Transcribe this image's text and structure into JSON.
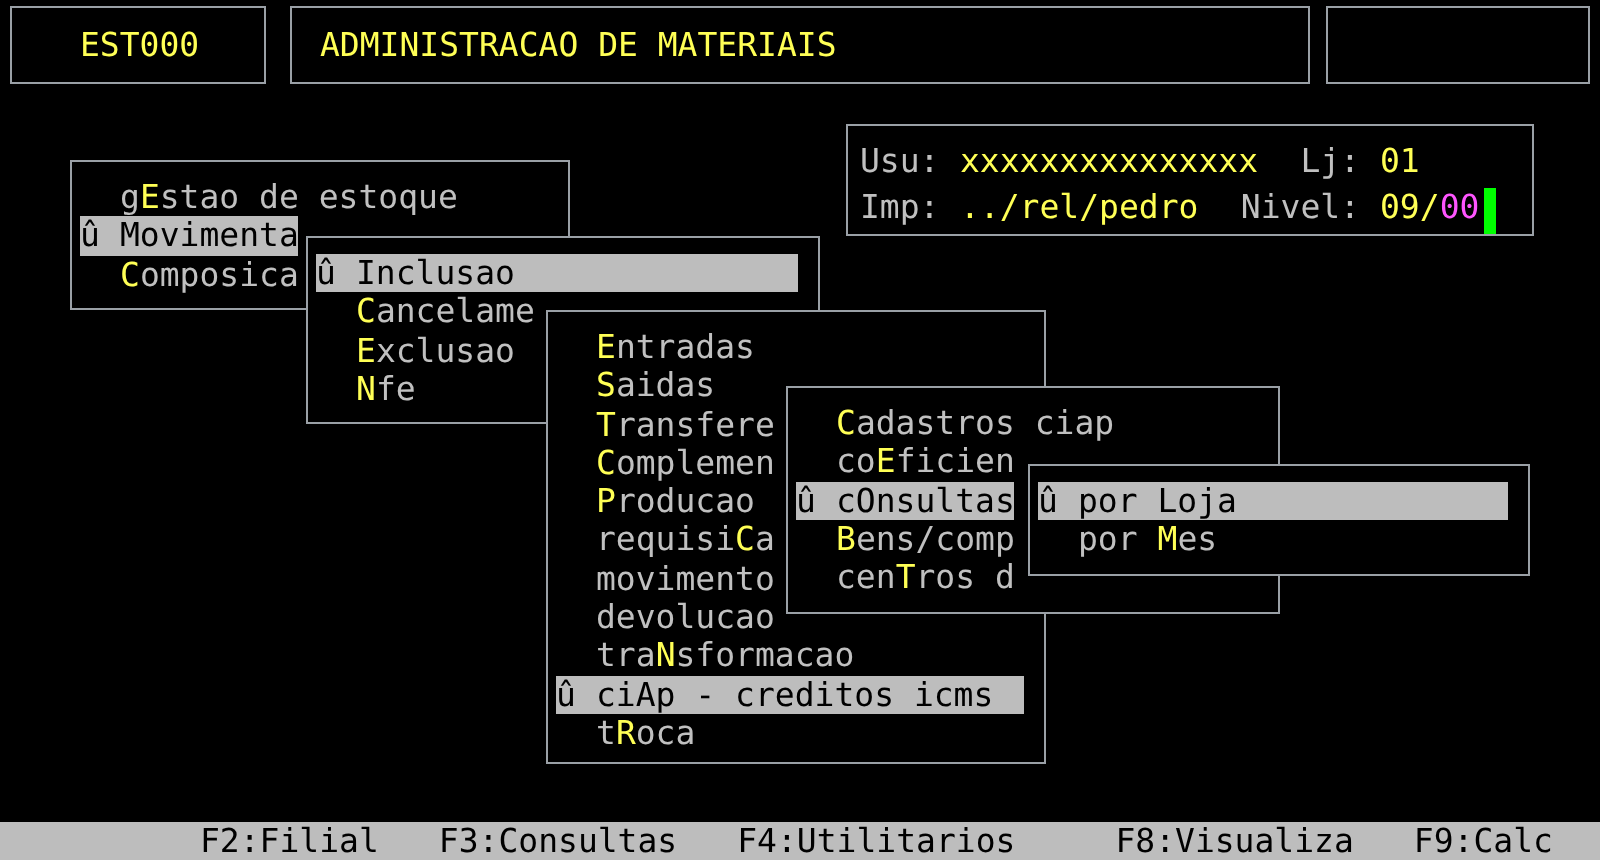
{
  "header": {
    "code": "EST000",
    "title": "ADMINISTRACAO DE MATERIAIS"
  },
  "session": {
    "user_label": "Usu:",
    "user": "xxxxxxxxxxxxxxx",
    "store_label": "Lj:",
    "store": "01",
    "printer_label": "Imp:",
    "printer": "../rel/pedro",
    "level_label": "Nivel:",
    "level_value": "09/",
    "level_sub": "00"
  },
  "menus": [
    {
      "items": [
        {
          "selected": false,
          "parts": [
            {
              "text": "g",
              "hotkey": false
            },
            {
              "text": "E",
              "hotkey": true
            },
            {
              "text": "stao de estoque",
              "hotkey": false
            }
          ]
        },
        {
          "selected": true,
          "prefix": "û",
          "parts": [
            {
              "text": "Movimenta",
              "hotkey": false
            }
          ]
        },
        {
          "selected": false,
          "parts": [
            {
              "text": "C",
              "hotkey": true
            },
            {
              "text": "omposica",
              "hotkey": false
            }
          ]
        }
      ]
    },
    {
      "items": [
        {
          "selected": true,
          "prefix": "û",
          "parts": [
            {
              "text": "Inclusao",
              "hotkey": false
            }
          ]
        },
        {
          "selected": false,
          "parts": [
            {
              "text": "C",
              "hotkey": true
            },
            {
              "text": "ancelame",
              "hotkey": false
            }
          ]
        },
        {
          "selected": false,
          "parts": [
            {
              "text": "E",
              "hotkey": true
            },
            {
              "text": "xclusao",
              "hotkey": false
            }
          ]
        },
        {
          "selected": false,
          "parts": [
            {
              "text": "N",
              "hotkey": true
            },
            {
              "text": "fe",
              "hotkey": false
            }
          ]
        }
      ]
    },
    {
      "items": [
        {
          "selected": false,
          "parts": [
            {
              "text": "E",
              "hotkey": true
            },
            {
              "text": "ntradas",
              "hotkey": false
            }
          ]
        },
        {
          "selected": false,
          "parts": [
            {
              "text": "S",
              "hotkey": true
            },
            {
              "text": "aidas",
              "hotkey": false
            }
          ]
        },
        {
          "selected": false,
          "parts": [
            {
              "text": "T",
              "hotkey": true
            },
            {
              "text": "ransfere",
              "hotkey": false
            }
          ]
        },
        {
          "selected": false,
          "parts": [
            {
              "text": "C",
              "hotkey": true
            },
            {
              "text": "omplemen",
              "hotkey": false
            }
          ]
        },
        {
          "selected": false,
          "parts": [
            {
              "text": "P",
              "hotkey": true
            },
            {
              "text": "roducao",
              "hotkey": false
            }
          ]
        },
        {
          "selected": false,
          "parts": [
            {
              "text": "requisi",
              "hotkey": false
            },
            {
              "text": "C",
              "hotkey": true
            },
            {
              "text": "a",
              "hotkey": false
            }
          ]
        },
        {
          "selected": false,
          "parts": [
            {
              "text": "movimento",
              "hotkey": false
            }
          ]
        },
        {
          "selected": false,
          "parts": [
            {
              "text": "devolucao",
              "hotkey": false
            }
          ]
        },
        {
          "selected": false,
          "parts": [
            {
              "text": "tra",
              "hotkey": false
            },
            {
              "text": "N",
              "hotkey": true
            },
            {
              "text": "sformacao",
              "hotkey": false
            }
          ]
        },
        {
          "selected": true,
          "prefix": "û",
          "parts": [
            {
              "text": "ciAp - creditos icms",
              "hotkey": false
            }
          ]
        },
        {
          "selected": false,
          "parts": [
            {
              "text": "t",
              "hotkey": false
            },
            {
              "text": "R",
              "hotkey": true
            },
            {
              "text": "oca",
              "hotkey": false
            }
          ]
        }
      ]
    },
    {
      "items": [
        {
          "selected": false,
          "parts": [
            {
              "text": "C",
              "hotkey": true
            },
            {
              "text": "adastros ciap",
              "hotkey": false
            }
          ]
        },
        {
          "selected": false,
          "parts": [
            {
              "text": "co",
              "hotkey": false
            },
            {
              "text": "E",
              "hotkey": true
            },
            {
              "text": "ficien",
              "hotkey": false
            }
          ]
        },
        {
          "selected": true,
          "prefix": "û",
          "parts": [
            {
              "text": "cOnsultas",
              "hotkey": false
            }
          ]
        },
        {
          "selected": false,
          "parts": [
            {
              "text": "B",
              "hotkey": true
            },
            {
              "text": "ens/comp",
              "hotkey": false
            }
          ]
        },
        {
          "selected": false,
          "parts": [
            {
              "text": "cen",
              "hotkey": false
            },
            {
              "text": "T",
              "hotkey": true
            },
            {
              "text": "ros d",
              "hotkey": false
            }
          ]
        }
      ]
    },
    {
      "items": [
        {
          "selected": true,
          "prefix": "û",
          "parts": [
            {
              "text": "por Loja",
              "hotkey": false
            }
          ]
        },
        {
          "selected": false,
          "parts": [
            {
              "text": "por ",
              "hotkey": false
            },
            {
              "text": "M",
              "hotkey": true
            },
            {
              "text": "es",
              "hotkey": false
            }
          ]
        }
      ]
    }
  ],
  "function_keys": [
    "F2:Filial",
    "F3:Consultas",
    "F4:Utilitarios",
    "F8:Visualiza",
    "F9:Calc"
  ]
}
